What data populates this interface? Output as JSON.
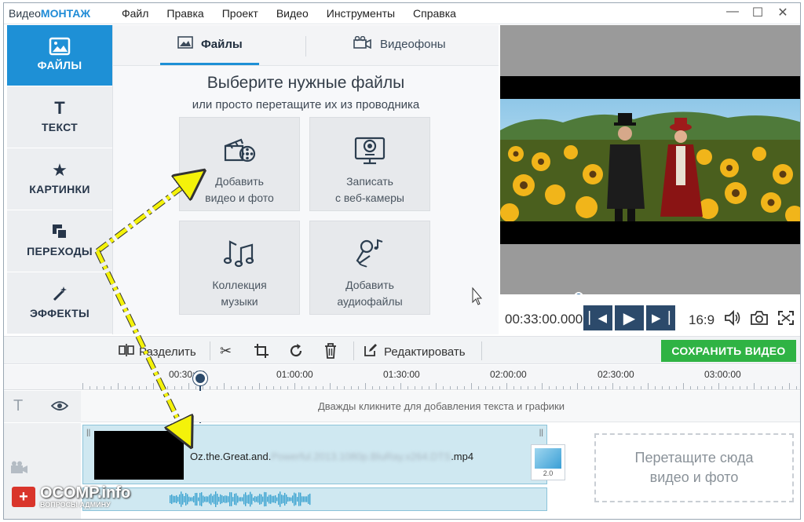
{
  "app": {
    "logo_prefix": "Видео",
    "logo_accent": "МОНТАЖ",
    "menu": [
      "Файл",
      "Правка",
      "Проект",
      "Видео",
      "Инструменты",
      "Справка"
    ],
    "window_controls": [
      "—",
      "☐",
      "✕"
    ]
  },
  "leftnav": [
    {
      "label": "ФАЙЛЫ",
      "icon": "picture-icon",
      "active": true
    },
    {
      "label": "ТЕКСТ",
      "icon": "text-icon",
      "active": false
    },
    {
      "label": "КАРТИНКИ",
      "icon": "star-icon",
      "active": false
    },
    {
      "label": "ПЕРЕХОДЫ",
      "icon": "transitions-icon",
      "active": false
    },
    {
      "label": "ЭФФЕКТЫ",
      "icon": "magic-wand-icon",
      "active": false
    }
  ],
  "files_panel": {
    "tabs": [
      {
        "label": "Файлы",
        "icon": "image-icon",
        "active": true
      },
      {
        "label": "Видеофоны",
        "icon": "film-camera-icon",
        "active": false
      }
    ],
    "heading": "Выберите нужные файлы",
    "subheading": "или просто перетащите их из проводника",
    "tiles": [
      {
        "label": "Добавить\nвидео и фото",
        "icon": "clapper-film-icon"
      },
      {
        "label": "Записать\nс веб-камеры",
        "icon": "webcam-icon"
      },
      {
        "label": "Коллекция\nмузыки",
        "icon": "music-notes-icon"
      },
      {
        "label": "Добавить\nаудиофайлы",
        "icon": "microphone-icon"
      }
    ]
  },
  "preview": {
    "timecode": "00:33:00.000",
    "aspect": "16:9",
    "progress": 0.26
  },
  "toolbar": {
    "split_label": "Разделить",
    "edit_label": "Редактировать",
    "save_label": "СОХРАНИТЬ ВИДЕО"
  },
  "timeline": {
    "ruler_labels": [
      "00:30:00",
      "01:00:00",
      "01:30:00",
      "02:00:00",
      "02:30:00",
      "03:00:00"
    ],
    "text_track_hint": "Дважды кликните для добавления текста и графики",
    "clip_name_start": "Oz.the.Great.and.",
    "clip_name_blurred": "Powerful.2013.1080p.BluRay.x264.DTS",
    "clip_name_end": ".mp4",
    "transition_duration": "2.0",
    "dropzone": "Перетащите сюда\nвидео и фото"
  },
  "watermark": {
    "title": "OCOMP.info",
    "subtitle": "ВОПРОСЫ АДМИНУ"
  },
  "colors": {
    "accent_blue": "#1e90d6",
    "save_green": "#2fb344",
    "annotation_yellow": "#f4f20a"
  }
}
